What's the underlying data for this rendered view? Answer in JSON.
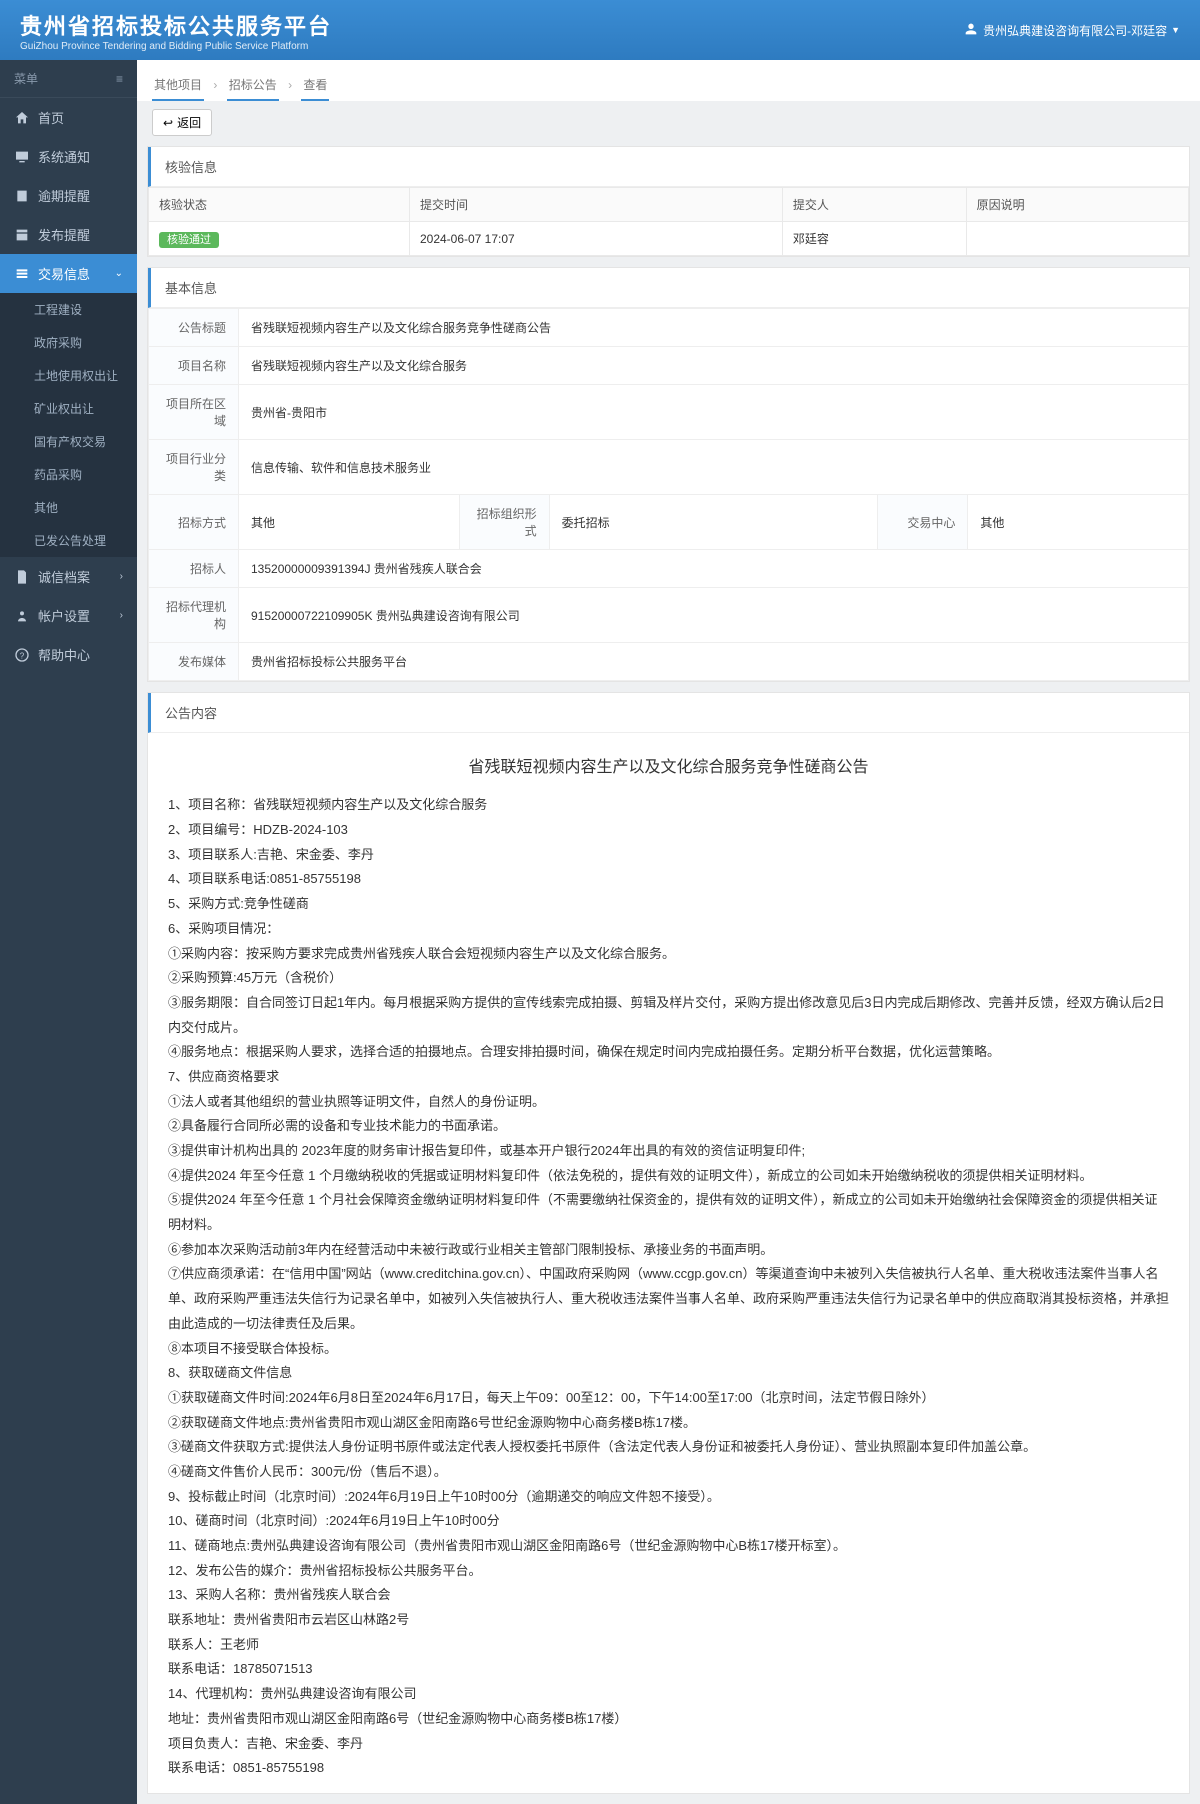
{
  "header": {
    "title": "贵州省招标投标公共服务平台",
    "subtitle": "GuiZhou Province Tendering and Bidding Public Service Platform",
    "user": "贵州弘典建设咨询有限公司-邓廷容"
  },
  "sidebar": {
    "menuLabel": "菜单",
    "items": {
      "home": "首页",
      "sysNotice": "系统通知",
      "overdueRemind": "逾期提醒",
      "publishRemind": "发布提醒",
      "tradeInfo": "交易信息",
      "creditFile": "诚信档案",
      "account": "帐户设置",
      "help": "帮助中心"
    },
    "sub": {
      "engineering": "工程建设",
      "govPurchase": "政府采购",
      "landUse": "土地使用权出让",
      "mining": "矿业权出让",
      "stateAsset": "国有产权交易",
      "medicine": "药品采购",
      "other": "其他",
      "published": "已发公告处理"
    }
  },
  "breadcrumb": {
    "a": "其他项目",
    "b": "招标公告",
    "c": "查看"
  },
  "backBtn": "返回",
  "panels": {
    "verifyTitle": "核验信息",
    "basicTitle": "基本信息",
    "contentTitle": "公告内容"
  },
  "verify": {
    "hStatus": "核验状态",
    "hSubmitTime": "提交时间",
    "hSubmitter": "提交人",
    "hReason": "原因说明",
    "status": "核验通过",
    "time": "2024-06-07 17:07",
    "submitter": "邓廷容",
    "reason": ""
  },
  "basic": {
    "lTitle": "公告标题",
    "vTitle": "省残联短视频内容生产以及文化综合服务竞争性磋商公告",
    "lProj": "项目名称",
    "vProj": "省残联短视频内容生产以及文化综合服务",
    "lArea": "项目所在区域",
    "vArea": "贵州省-贵阳市",
    "lIndustry": "项目行业分类",
    "vIndustry": "信息传输、软件和信息技术服务业",
    "lMethod": "招标方式",
    "vMethod": "其他",
    "lOrg": "招标组织形式",
    "vOrg": "委托招标",
    "lCenter": "交易中心",
    "vCenter": "其他",
    "lOwner": "招标人",
    "vOwner": "13520000009391394J 贵州省残疾人联合会",
    "lAgent": "招标代理机构",
    "vAgent": "91520000722109905K 贵州弘典建设咨询有限公司",
    "lMedia": "发布媒体",
    "vMedia": "贵州省招标投标公共服务平台"
  },
  "notice": {
    "title": "省残联短视频内容生产以及文化综合服务竞争性磋商公告",
    "lines": [
      "1、项目名称：省残联短视频内容生产以及文化综合服务",
      "2、项目编号：HDZB-2024-103",
      "3、项目联系人:吉艳、宋金委、李丹",
      "4、项目联系电话:0851-85755198",
      "5、采购方式:竞争性磋商",
      "6、采购项目情况：",
      "①采购内容：按采购方要求完成贵州省残疾人联合会短视频内容生产以及文化综合服务。",
      "②采购预算:45万元（含税价）",
      "③服务期限：自合同签订日起1年内。每月根据采购方提供的宣传线索完成拍摄、剪辑及样片交付，采购方提出修改意见后3日内完成后期修改、完善并反馈，经双方确认后2日内交付成片。",
      "④服务地点：根据采购人要求，选择合适的拍摄地点。合理安排拍摄时间，确保在规定时间内完成拍摄任务。定期分析平台数据，优化运营策略。",
      "7、供应商资格要求",
      "①法人或者其他组织的营业执照等证明文件，自然人的身份证明。",
      "②具备履行合同所必需的设备和专业技术能力的书面承诺。",
      "③提供审计机构出具的 2023年度的财务审计报告复印件，或基本开户银行2024年出具的有效的资信证明复印件;",
      "④提供2024 年至今任意 1 个月缴纳税收的凭据或证明材料复印件（依法免税的，提供有效的证明文件），新成立的公司如未开始缴纳税收的须提供相关证明材料。",
      "⑤提供2024 年至今任意 1 个月社会保障资金缴纳证明材料复印件（不需要缴纳社保资金的，提供有效的证明文件），新成立的公司如未开始缴纳社会保障资金的须提供相关证明材料。",
      "⑥参加本次采购活动前3年内在经营活动中未被行政或行业相关主管部门限制投标、承接业务的书面声明。",
      "⑦供应商须承诺：在“信用中国”网站（www.creditchina.gov.cn）、中国政府采购网（www.ccgp.gov.cn）等渠道查询中未被列入失信被执行人名单、重大税收违法案件当事人名单、政府采购严重违法失信行为记录名单中，如被列入失信被执行人、重大税收违法案件当事人名单、政府采购严重违法失信行为记录名单中的供应商取消其投标资格，并承担由此造成的一切法律责任及后果。",
      "⑧本项目不接受联合体投标。",
      "8、获取磋商文件信息",
      "①获取磋商文件时间:2024年6月8日至2024年6月17日，每天上午09：00至12：00，下午14:00至17:00（北京时间，法定节假日除外）",
      "②获取磋商文件地点:贵州省贵阳市观山湖区金阳南路6号世纪金源购物中心商务楼B栋17楼。",
      "③磋商文件获取方式:提供法人身份证明书原件或法定代表人授权委托书原件（含法定代表人身份证和被委托人身份证）、营业执照副本复印件加盖公章。",
      "④磋商文件售价人民币：300元/份（售后不退）。",
      "9、投标截止时间（北京时间）:2024年6月19日上午10时00分（逾期递交的响应文件恕不接受）。",
      "10、磋商时间（北京时间）:2024年6月19日上午10时00分",
      "11、磋商地点:贵州弘典建设咨询有限公司（贵州省贵阳市观山湖区金阳南路6号（世纪金源购物中心B栋17楼开标室）。",
      "12、发布公告的媒介：贵州省招标投标公共服务平台。",
      "13、采购人名称：贵州省残疾人联合会",
      "联系地址：贵州省贵阳市云岩区山林路2号",
      "联系人：王老师",
      "联系电话：18785071513",
      "14、代理机构：贵州弘典建设咨询有限公司",
      "地址：贵州省贵阳市观山湖区金阳南路6号（世纪金源购物中心商务楼B栋17楼）",
      "项目负责人：吉艳、宋金委、李丹",
      "联系电话：0851-85755198"
    ]
  }
}
